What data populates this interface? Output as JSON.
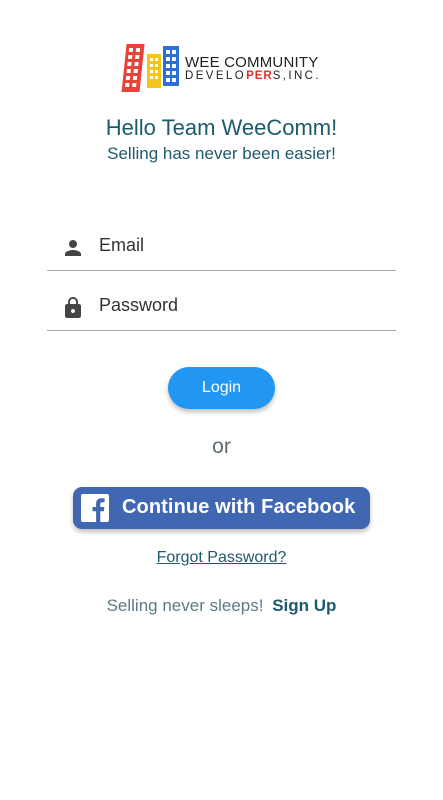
{
  "logo": {
    "line1": "WEE COMMUNITY",
    "line2_a": "DEVELO",
    "line2_b": "PER",
    "line2_c": "S,INC."
  },
  "header": {
    "greeting": "Hello Team WeeComm!",
    "tagline": "Selling has never been easier!"
  },
  "form": {
    "email_placeholder": "Email",
    "email_value": "",
    "password_placeholder": "Password",
    "password_value": "",
    "email_icon": "person-icon",
    "password_icon": "lock-icon"
  },
  "actions": {
    "login_label": "Login",
    "or_label": "or",
    "facebook_label": "Continue with Facebook",
    "facebook_icon": "facebook-icon",
    "forgot_label": "Forgot Password?",
    "signup_prompt": "Selling never sleeps!",
    "signup_label": "Sign Up"
  },
  "colors": {
    "primary": "#2196f3",
    "facebook": "#4267b2",
    "text_teal": "#1e5a6e"
  }
}
